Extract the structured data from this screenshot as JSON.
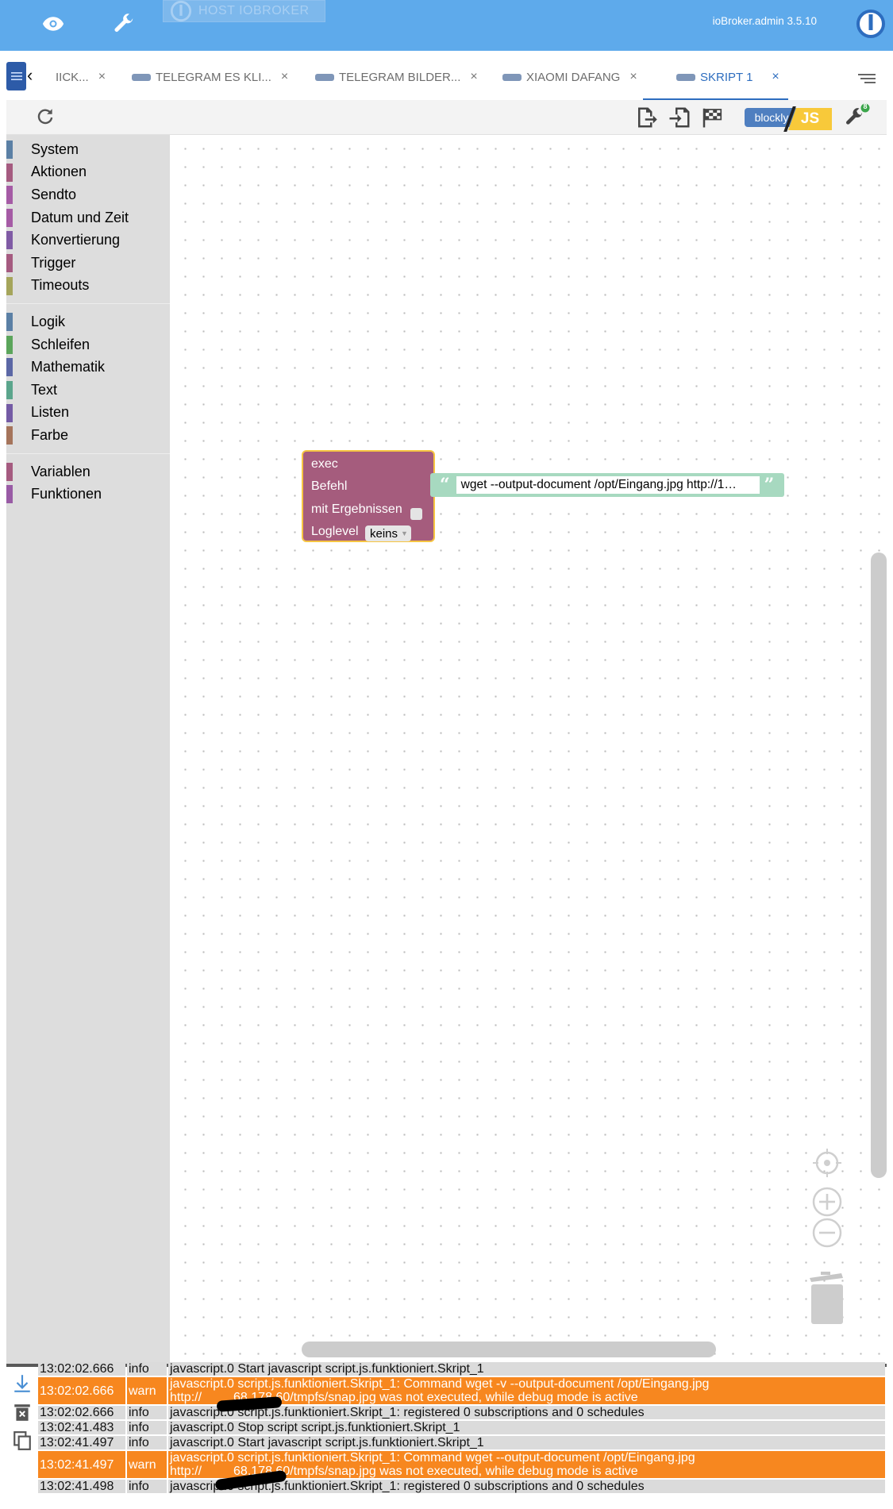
{
  "header": {
    "host_label": "HOST IOBROKER",
    "admin_version": "ioBroker.admin 3.5.10",
    "icons": [
      "eye-icon",
      "wrench-icon",
      "power-icon"
    ]
  },
  "tabs": [
    {
      "label": "IICK...",
      "active": false
    },
    {
      "label": "TELEGRAM ES KLI...",
      "active": false
    },
    {
      "label": "TELEGRAM BILDER...",
      "active": false
    },
    {
      "label": "XIAOMI DAFANG",
      "active": false
    },
    {
      "label": "SKRIPT 1",
      "active": true
    }
  ],
  "tab_close_symbol": "×",
  "toolbar": {
    "blockly_label": "blockly",
    "js_label": "JS",
    "badge_count": "8"
  },
  "categories_group1": [
    {
      "label": "System",
      "color": "#5b80a5"
    },
    {
      "label": "Aktionen",
      "color": "#a55b80"
    },
    {
      "label": "Sendto",
      "color": "#a55ba5"
    },
    {
      "label": "Datum und Zeit",
      "color": "#a55ba5"
    },
    {
      "label": "Konvertierung",
      "color": "#805ba5"
    },
    {
      "label": "Trigger",
      "color": "#a55b80"
    },
    {
      "label": "Timeouts",
      "color": "#a5a55b"
    }
  ],
  "categories_group2": [
    {
      "label": "Logik",
      "color": "#5b80a5"
    },
    {
      "label": "Schleifen",
      "color": "#5ba55b"
    },
    {
      "label": "Mathematik",
      "color": "#5b67a5"
    },
    {
      "label": "Text",
      "color": "#5ba58c"
    },
    {
      "label": "Listen",
      "color": "#745ba5"
    },
    {
      "label": "Farbe",
      "color": "#a5745b"
    }
  ],
  "categories_group3": [
    {
      "label": "Variablen",
      "color": "#a55b80"
    },
    {
      "label": "Funktionen",
      "color": "#995ba5"
    }
  ],
  "exec_block": {
    "title": "exec",
    "command_label": "Befehl",
    "results_label": "mit Ergebnissen",
    "loglevel_label": "Loglevel",
    "loglevel_value": "keins",
    "command_value": "wget --output-document /opt/Eingang.jpg http://1…"
  },
  "log": [
    {
      "time": "13:02:02.666",
      "level": "info",
      "msg": "javascript.0 Start javascript script.js.funktioniert.Skript_1"
    },
    {
      "time": "13:02:02.666",
      "level": "warn",
      "msg": "javascript.0 script.js.funktioniert.Skript_1: Command wget -v --output-document /opt/Eingang.jpg\nhttp://         68.178.60/tmpfs/snap.jpg was not executed, while debug mode is active"
    },
    {
      "time": "13:02:02.666",
      "level": "info",
      "msg": "javascript.0 script.js.funktioniert.Skript_1: registered 0 subscriptions and 0 schedules"
    },
    {
      "time": "13:02:41.483",
      "level": "info",
      "msg": "javascript.0 Stop script script.js.funktioniert.Skript_1"
    },
    {
      "time": "13:02:41.497",
      "level": "info",
      "msg": "javascript.0 Start javascript script.js.funktioniert.Skript_1"
    },
    {
      "time": "13:02:41.497",
      "level": "warn",
      "msg": "javascript.0 script.js.funktioniert.Skript_1: Command wget --output-document /opt/Eingang.jpg\nhttp://         68.178.60/tmpfs/snap.jpg was not executed, while debug mode is active"
    },
    {
      "time": "13:02:41.498",
      "level": "info",
      "msg": "javascript.0 script.js.funktioniert.Skript_1: registered 0 subscriptions and 0 schedules"
    }
  ]
}
